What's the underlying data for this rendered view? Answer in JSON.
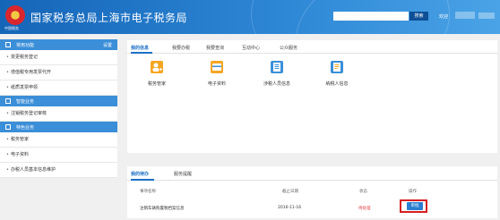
{
  "header": {
    "title": "国家税务总局上海市电子税务局",
    "search_button": "搜索",
    "welcome": "欢迎",
    "brand_color": "#1f73c6"
  },
  "sidebar": {
    "groups": [
      {
        "title": "常用功能",
        "action": "设置",
        "icon": "home-icon",
        "items": [
          "变更税务登记",
          "增值税专用发票代开",
          "纸质发票申领"
        ]
      },
      {
        "title": "智能业务",
        "icon": "doc-icon",
        "items": [
          "注销税务登记审核"
        ]
      },
      {
        "title": "特色业务",
        "icon": "star-icon",
        "items": [
          "税务管家",
          "电子资料",
          "办税人员基本信息维护"
        ]
      }
    ]
  },
  "main": {
    "tabs": [
      "我的信息",
      "我要办税",
      "我要查询",
      "互动中心",
      "公众服务"
    ],
    "active_tab": 0,
    "tiles": [
      {
        "label": "税务管家",
        "icon": "user-plus-icon",
        "color": "#f5a623"
      },
      {
        "label": "电子资料",
        "icon": "wallet-icon",
        "color": "#f5a623"
      },
      {
        "label": "涉税人员信息",
        "icon": "list-icon",
        "color": "#3a8fd9"
      },
      {
        "label": "纳税人信息",
        "icon": "person-list-icon",
        "color": "#3a8fd9"
      }
    ]
  },
  "todo": {
    "tabs": [
      "我的待办",
      "服务提醒"
    ],
    "columns": [
      "事项名称",
      "截止日期",
      "状态",
      "操作"
    ],
    "rows": [
      {
        "name": "注销车辆购置税档案信息",
        "deadline": "2016-11-16",
        "status": "待处理",
        "action": "审批"
      }
    ],
    "status_color": "#e04040",
    "highlight_color": "#d61f1f"
  }
}
